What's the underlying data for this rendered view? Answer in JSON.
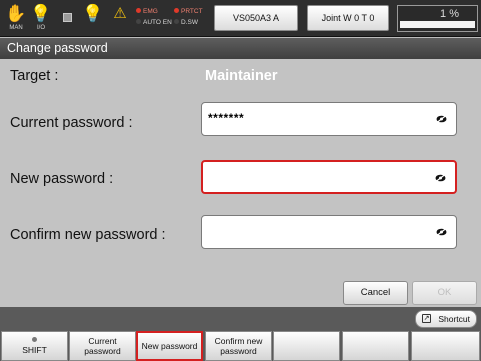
{
  "topbar": {
    "icons": [
      {
        "name": "teach-hand-icon",
        "glyph": "✋",
        "caption": "MAN"
      },
      {
        "name": "io-lamp-icon",
        "glyph": "💡",
        "caption": "I/O"
      },
      {
        "name": "stop-square-icon"
      },
      {
        "name": "light-bulb-icon",
        "glyph": "💡"
      },
      {
        "name": "warning-wrench-icon",
        "glyph": "⚠"
      }
    ],
    "lamps": {
      "emg": "EMG",
      "prtct": "PRTCT",
      "auto_en": "AUTO EN",
      "dsw": "D.SW"
    },
    "robot_button": "VS050A3 A",
    "coord_button": "Joint  W 0 T 0",
    "speed": "1 %"
  },
  "title": "Change password",
  "form": {
    "target_label": "Target :",
    "target_value": "Maintainer",
    "current_label": "Current password :",
    "current_value": "*******",
    "new_label": "New password :",
    "new_value": "",
    "confirm_label": "Confirm new password :",
    "confirm_value": "",
    "cancel": "Cancel",
    "ok": "OK"
  },
  "bottom": {
    "shortcut": "Shortcut",
    "keys": [
      {
        "line1": "",
        "line2": "SHIFT"
      },
      {
        "line1": "Current",
        "line2": "password"
      },
      {
        "line1": "New password",
        "line2": ""
      },
      {
        "line1": "Confirm new",
        "line2": "password"
      },
      {
        "line1": "",
        "line2": ""
      },
      {
        "line1": "",
        "line2": ""
      },
      {
        "line1": "",
        "line2": ""
      }
    ]
  },
  "colors": {
    "highlight": "#d42020",
    "background": "#c3c3c3",
    "topbar": "#2e2e2e"
  }
}
